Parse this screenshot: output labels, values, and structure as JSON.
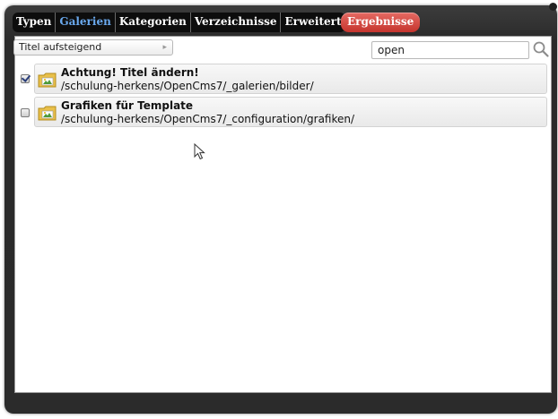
{
  "tabs": [
    {
      "label": "Typen",
      "active": false
    },
    {
      "label": "Galerien",
      "active": true
    },
    {
      "label": "Kategorien",
      "active": false
    },
    {
      "label": "Verzeichnisse",
      "active": false
    },
    {
      "label": "Erweitert",
      "active": false
    }
  ],
  "results_button": {
    "label": "Ergebnisse"
  },
  "sort": {
    "selected": "Titel aufsteigend"
  },
  "search": {
    "value": "open"
  },
  "galleries": [
    {
      "title": "Achtung! Titel ändern!",
      "path": "/schulung-herkens/OpenCms7/_galerien/bilder/",
      "checked": true
    },
    {
      "title": "Grafiken für Template",
      "path": "/schulung-herkens/OpenCms7/_configuration/grafiken/",
      "checked": false
    }
  ],
  "colors": {
    "active_tab": "#6aa9ee",
    "results_button": "#d9473f",
    "window_background": "#2b2b2b"
  }
}
